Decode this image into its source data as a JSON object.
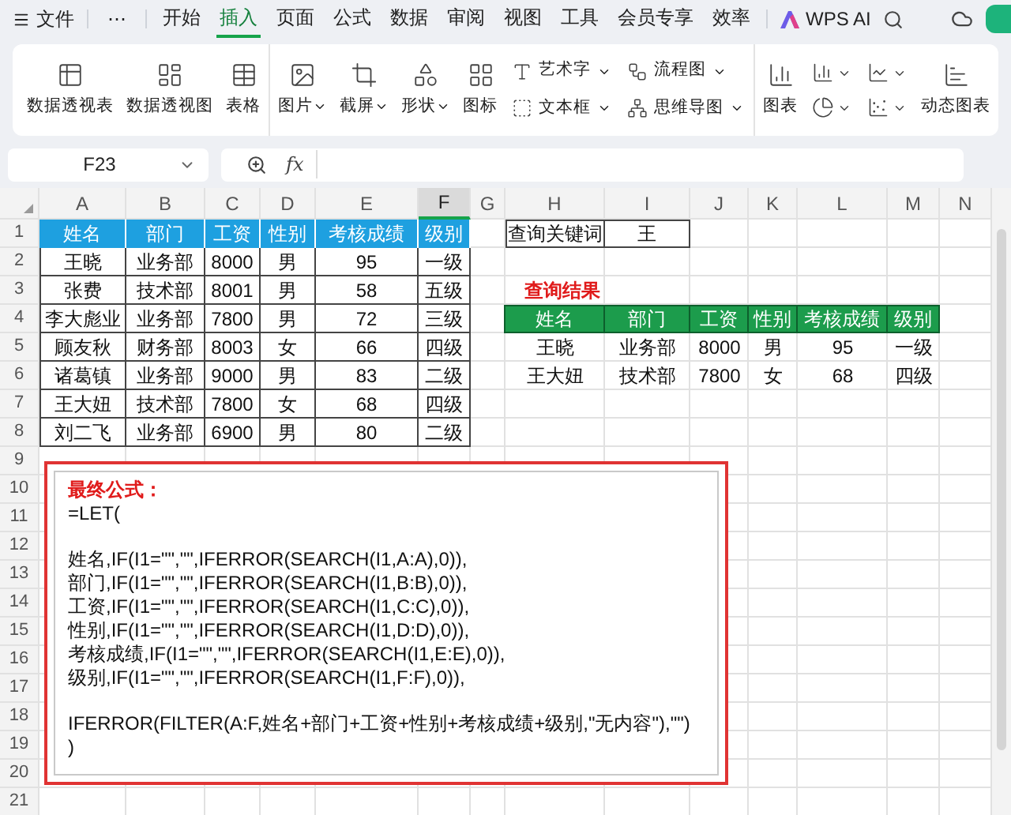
{
  "menu": {
    "file": "文件",
    "more": "⋯",
    "tabs": [
      {
        "label": "开始",
        "selected": false
      },
      {
        "label": "插入",
        "selected": true
      },
      {
        "label": "页面",
        "selected": false
      },
      {
        "label": "公式",
        "selected": false
      },
      {
        "label": "数据",
        "selected": false
      },
      {
        "label": "审阅",
        "selected": false
      },
      {
        "label": "视图",
        "selected": false
      },
      {
        "label": "工具",
        "selected": false
      },
      {
        "label": "会员专享",
        "selected": false
      },
      {
        "label": "效率",
        "selected": false
      }
    ],
    "ai": "WPS AI"
  },
  "ribbon": [
    [
      {
        "kind": "large",
        "label": "数据透视表",
        "dropdown": false
      },
      {
        "kind": "large",
        "label": "数据透视图",
        "dropdown": false
      },
      {
        "kind": "large",
        "label": "表格",
        "dropdown": false
      }
    ],
    [
      {
        "kind": "large",
        "label": "图片",
        "dropdown": true
      },
      {
        "kind": "large",
        "label": "截屏",
        "dropdown": true
      },
      {
        "kind": "large",
        "label": "形状",
        "dropdown": true
      },
      {
        "kind": "large",
        "label": "图标",
        "dropdown": false
      },
      {
        "kind": "stack",
        "items": [
          {
            "label": "艺术字",
            "dropdown": true
          },
          {
            "label": "文本框",
            "dropdown": true
          }
        ]
      },
      {
        "kind": "stack",
        "items": [
          {
            "label": "流程图",
            "dropdown": true
          },
          {
            "label": "思维导图",
            "dropdown": true
          }
        ]
      }
    ],
    [
      {
        "kind": "large",
        "label": "图表",
        "dropdown": false
      },
      {
        "kind": "icon_stack",
        "items": [
          {
            "dropdown": true
          },
          {
            "dropdown": true
          }
        ]
      },
      {
        "kind": "icon_stack",
        "items": [
          {
            "dropdown": true
          },
          {
            "dropdown": true
          }
        ]
      },
      {
        "kind": "large",
        "label": "动态图表",
        "dropdown": false
      }
    ]
  ],
  "formula_bar": {
    "name_box": "F23",
    "fx": "fx"
  },
  "columns": [
    {
      "label": "A",
      "selected": false
    },
    {
      "label": "B",
      "selected": false
    },
    {
      "label": "C",
      "selected": false
    },
    {
      "label": "D",
      "selected": false
    },
    {
      "label": "E",
      "selected": false
    },
    {
      "label": "F",
      "selected": true
    },
    {
      "label": "G",
      "selected": false
    },
    {
      "label": "H",
      "selected": false
    },
    {
      "label": "I",
      "selected": false
    },
    {
      "label": "J",
      "selected": false
    },
    {
      "label": "K",
      "selected": false
    },
    {
      "label": "L",
      "selected": false
    },
    {
      "label": "M",
      "selected": false
    },
    {
      "label": "N",
      "selected": false
    }
  ],
  "row_numbers": [
    "1",
    "2",
    "3",
    "4",
    "5",
    "6",
    "7",
    "8",
    "9",
    "10",
    "11",
    "12",
    "13",
    "14",
    "15",
    "16",
    "17",
    "18",
    "19",
    "20",
    "21"
  ],
  "source_table": {
    "header": [
      "姓名",
      "部门",
      "工资",
      "性别",
      "考核成绩",
      "级别"
    ],
    "rows": [
      [
        "王晓",
        "业务部",
        "8000",
        "男",
        "95",
        "一级"
      ],
      [
        "张费",
        "技术部",
        "8001",
        "男",
        "58",
        "五级"
      ],
      [
        "李大彪业",
        "业务部",
        "7800",
        "男",
        "72",
        "三级"
      ],
      [
        "顾友秋",
        "财务部",
        "8003",
        "女",
        "66",
        "四级"
      ],
      [
        "诸葛镇",
        "业务部",
        "9000",
        "男",
        "83",
        "二级"
      ],
      [
        "王大妞",
        "技术部",
        "7800",
        "女",
        "68",
        "四级"
      ],
      [
        "刘二飞",
        "业务部",
        "6900",
        "男",
        "80",
        "二级"
      ]
    ]
  },
  "query": {
    "label": "查询关键词",
    "value": "王"
  },
  "result": {
    "title": "查询结果",
    "header": [
      "姓名",
      "部门",
      "工资",
      "性别",
      "考核成绩",
      "级别"
    ],
    "rows": [
      [
        "王晓",
        "业务部",
        "8000",
        "男",
        "95",
        "一级"
      ],
      [
        "王大妞",
        "技术部",
        "7800",
        "女",
        "68",
        "四级"
      ]
    ]
  },
  "formula_box": {
    "title": "最终公式：",
    "blocks": [
      [
        "=LET("
      ],
      [
        "姓名,IF(I1=\"\",\"\",IFERROR(SEARCH(I1,A:A),0)),",
        "部门,IF(I1=\"\",\"\",IFERROR(SEARCH(I1,B:B),0)),",
        "工资,IF(I1=\"\",\"\",IFERROR(SEARCH(I1,C:C),0)),",
        "性别,IF(I1=\"\",\"\",IFERROR(SEARCH(I1,D:D),0)),",
        "考核成绩,IF(I1=\"\",\"\",IFERROR(SEARCH(I1,E:E),0)),",
        "级别,IF(I1=\"\",\"\",IFERROR(SEARCH(I1,F:F),0)),"
      ],
      [
        "IFERROR(FILTER(A:F,姓名+部门+工资+性别+考核成绩+级别,\"无内容\"),\"\")",
        ")"
      ]
    ]
  }
}
